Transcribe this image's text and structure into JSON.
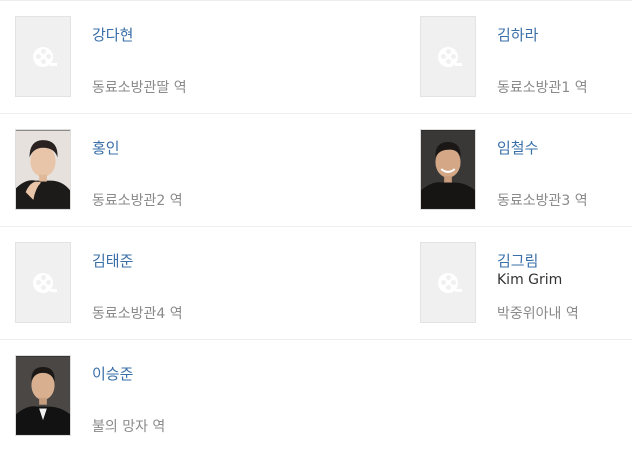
{
  "cast": [
    {
      "name": "강다현",
      "role": "동료소방관딸 역",
      "english_name": "",
      "photo": "placeholder"
    },
    {
      "name": "김하라",
      "role": "동료소방관1 역",
      "english_name": "",
      "photo": "placeholder"
    },
    {
      "name": "홍인",
      "role": "동료소방관2 역",
      "english_name": "",
      "photo": "portrait"
    },
    {
      "name": "임철수",
      "role": "동료소방관3 역",
      "english_name": "",
      "photo": "portrait"
    },
    {
      "name": "김태준",
      "role": "동료소방관4 역",
      "english_name": "",
      "photo": "placeholder"
    },
    {
      "name": "김그림",
      "role": "박중위아내 역",
      "english_name": "Kim Grim",
      "photo": "placeholder"
    },
    {
      "name": "이승준",
      "role": "불의 망자 역",
      "english_name": "",
      "photo": "portrait"
    }
  ],
  "colors": {
    "name_link": "#3a6fa8",
    "role_text": "#8a8a8a",
    "divider": "#eeeeee",
    "placeholder_bg": "#f0f0f0"
  },
  "icons": {
    "placeholder": "film-reel-icon",
    "portrait": "person-photo"
  }
}
